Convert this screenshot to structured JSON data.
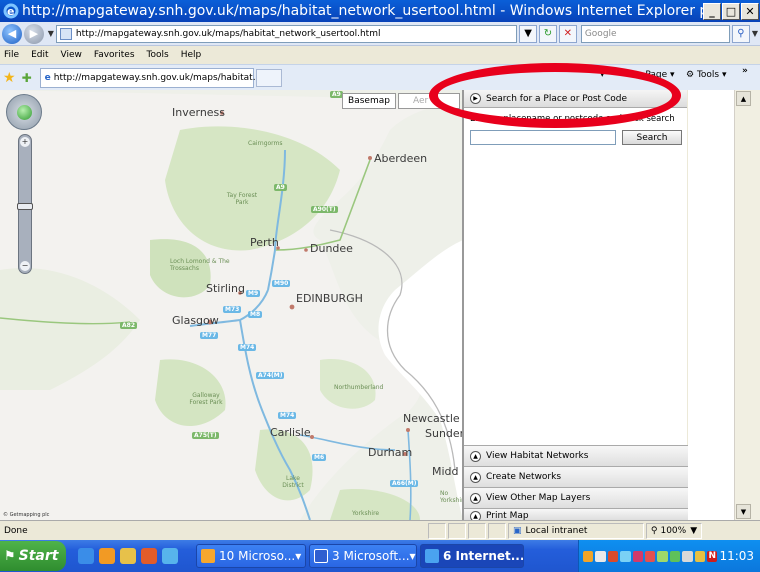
{
  "window": {
    "title": "http://mapgateway.snh.gov.uk/maps/habitat_network_usertool.html - Windows Internet Explorer provided b..."
  },
  "address": {
    "url": "http://mapgateway.snh.gov.uk/maps/habitat_network_usertool.html",
    "search_placeholder": "Google"
  },
  "menu": [
    "File",
    "Edit",
    "View",
    "Favorites",
    "Tools",
    "Help"
  ],
  "tab": {
    "label": "http://mapgateway.snh.gov.uk/maps/habitat..."
  },
  "commandbar": {
    "page_label": "Page",
    "tools_label": "Tools"
  },
  "map": {
    "basemap_label": "Basemap",
    "aerial_label": "Aer",
    "copyright": "© Getmapping plc",
    "cities": [
      "Inverness",
      "Aberdeen",
      "Perth",
      "Dundee",
      "Stirling",
      "EDINBURGH",
      "Glasgow",
      "Carlisle",
      "Newcastle",
      "Sunder",
      "Durham",
      "Midd"
    ],
    "areas": [
      "Cairngorms",
      "Tay Forest Park",
      "Loch Lomond & The Trossachs",
      "Galloway Forest Park",
      "Northumberland",
      "Lake District",
      "Yorkshire",
      "No Yorkshire"
    ],
    "roads": [
      "A9",
      "A90(T)",
      "A9",
      "A82",
      "M90",
      "M9",
      "M73",
      "M8",
      "M77",
      "M74",
      "A74(M)",
      "M74",
      "A75(T)",
      "M6",
      "A66(M)"
    ]
  },
  "panel": {
    "header": "Search for a Place or Post Code",
    "hint": "Enter a placename or postcode and click search",
    "search_button": "Search",
    "rows": [
      "View Habitat Networks",
      "Create Networks",
      "View Other Map Layers",
      "Print Map"
    ]
  },
  "status": {
    "left": "Done",
    "zone": "Local intranet",
    "zoom": "100%"
  },
  "taskbar": {
    "start": "Start",
    "buttons": [
      "10 Microso...",
      "3 Microsoft...",
      "6 Internet..."
    ],
    "clock": "11:03"
  },
  "colors": {
    "highlight": "#e8001c",
    "xp_blue": "#245edb",
    "map_green": "#dbe8cc",
    "motorway": "#6ab8e6"
  }
}
